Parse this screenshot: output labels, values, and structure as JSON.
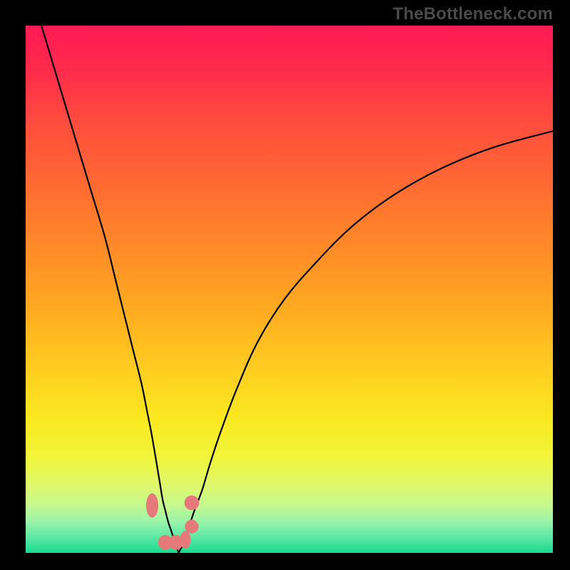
{
  "watermark": "TheBottleneck.com",
  "colors": {
    "background_frame": "#000000",
    "gradient_top": "#ff1a54",
    "gradient_mid": "#ffd020",
    "gradient_bottom": "#18db90",
    "curve": "#000000",
    "marker": "#e67a7a"
  },
  "chart_data": {
    "type": "line",
    "title": "",
    "xlabel": "",
    "ylabel": "",
    "xlim": [
      0,
      100
    ],
    "ylim": [
      0,
      100
    ],
    "grid": false,
    "legend": false,
    "note": "Axes are normalized to plot area; no tick labels shown in image. Values estimated from position.",
    "series": [
      {
        "name": "left-curve",
        "x": [
          3,
          6,
          9,
          12,
          15,
          17,
          19,
          20.5,
          22,
          23,
          23.8,
          24.5,
          25,
          25.5,
          26,
          26.5,
          27,
          27.5,
          28,
          28.5,
          29
        ],
        "y": [
          100,
          90,
          80,
          70,
          60,
          52,
          44,
          38,
          32,
          27,
          23,
          19,
          16,
          13,
          10,
          8,
          6,
          4.5,
          3,
          1.5,
          0
        ]
      },
      {
        "name": "right-curve",
        "x": [
          29,
          30,
          31,
          32,
          33.5,
          35,
          37,
          40,
          44,
          49,
          55,
          62,
          70,
          79,
          89,
          100
        ],
        "y": [
          0,
          2,
          5,
          8,
          12,
          17,
          23,
          31,
          40,
          48,
          55,
          62,
          68,
          73,
          77,
          80
        ]
      }
    ],
    "markers": [
      {
        "shape": "oval",
        "x": 24.0,
        "y": 9.0,
        "w": 2.3,
        "h": 4.6
      },
      {
        "shape": "circle",
        "x": 31.5,
        "y": 9.5,
        "r": 1.4
      },
      {
        "shape": "circle",
        "x": 26.5,
        "y": 2.0,
        "r": 1.4
      },
      {
        "shape": "circle",
        "x": 28.5,
        "y": 2.0,
        "r": 1.4
      },
      {
        "shape": "oval",
        "x": 30.3,
        "y": 2.5,
        "w": 2.0,
        "h": 3.4
      },
      {
        "shape": "circle",
        "x": 31.5,
        "y": 5.0,
        "r": 1.3
      }
    ]
  }
}
